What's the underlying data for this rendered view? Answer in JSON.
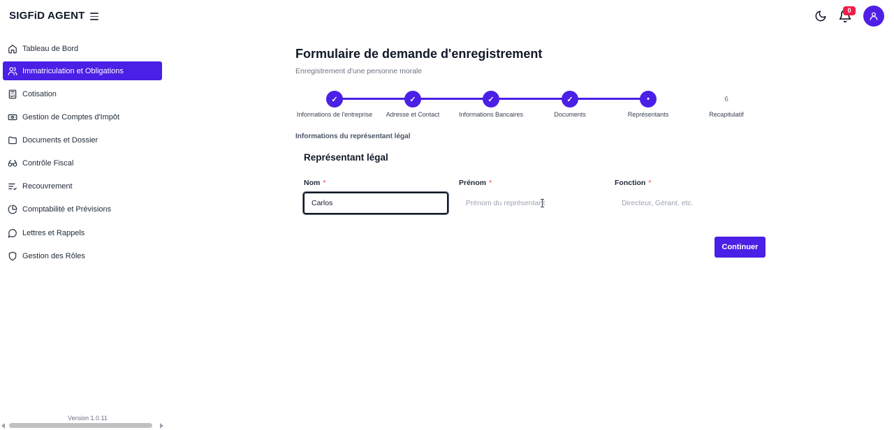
{
  "app": {
    "brand": "SIGFiD AGENT",
    "version": "Version 1.0.11"
  },
  "header": {
    "notification_count": "0"
  },
  "colors": {
    "accent": "#4a1fe6",
    "badge": "#ef1d48"
  },
  "sidebar": {
    "items": [
      {
        "label": "Tableau de Bord",
        "icon": "home-icon",
        "active": false
      },
      {
        "label": "Immatriculation et Obligations",
        "icon": "users-icon",
        "active": true
      },
      {
        "label": "Cotisation",
        "icon": "calculator-icon",
        "active": false
      },
      {
        "label": "Gestion de Comptes d'Impôt",
        "icon": "banknote-icon",
        "active": false
      },
      {
        "label": "Documents et Dossier",
        "icon": "folder-icon",
        "active": false
      },
      {
        "label": "Contrôle Fiscal",
        "icon": "glasses-icon",
        "active": false
      },
      {
        "label": "Recouvrement",
        "icon": "list-check-icon",
        "active": false
      },
      {
        "label": "Comptabilité et Prévisions",
        "icon": "pie-chart-icon",
        "active": false
      },
      {
        "label": "Lettres et Rappels",
        "icon": "message-circle-icon",
        "active": false
      },
      {
        "label": "Gestion des Rôles",
        "icon": "shield-icon",
        "active": false
      }
    ]
  },
  "main": {
    "title": "Formulaire de demande d'enregistrement",
    "subtitle": "Enregistrement d'une personne morale",
    "steps": [
      {
        "label": "Informations de l'entreprise",
        "state": "done",
        "marker": "✓"
      },
      {
        "label": "Adresse et Contact",
        "state": "done",
        "marker": "✓"
      },
      {
        "label": "Informations Bancaires",
        "state": "done",
        "marker": "✓"
      },
      {
        "label": "Documents",
        "state": "done",
        "marker": "✓"
      },
      {
        "label": "Représentants",
        "state": "current",
        "marker": "•"
      },
      {
        "label": "Recapitulatif",
        "state": "todo",
        "marker": "6"
      }
    ],
    "section_label": "Informations du représentant légal",
    "card_title": "Représentant légal",
    "fields": {
      "nom": {
        "label": "Nom",
        "required": "*",
        "value": "Carlos",
        "placeholder": ""
      },
      "prenom": {
        "label": "Prénom",
        "required": "*",
        "value": "",
        "placeholder": "Prénom du représentant"
      },
      "fonction": {
        "label": "Fonction",
        "required": "*",
        "value": "",
        "placeholder": "Directeur, Gérant, etc."
      }
    },
    "continue_label": "Continuer"
  }
}
